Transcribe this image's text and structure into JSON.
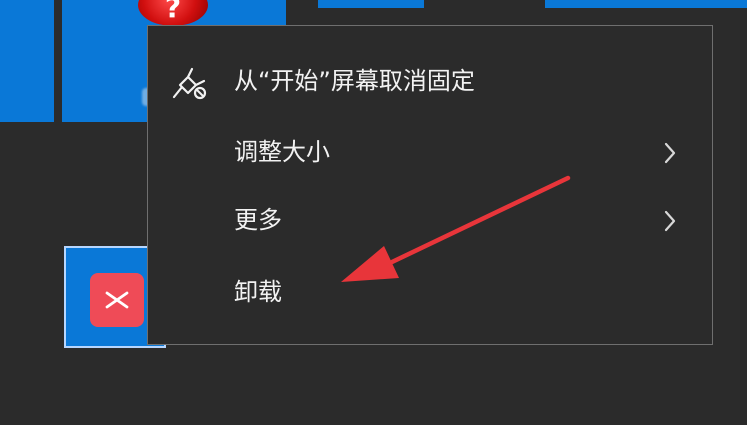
{
  "menu": {
    "items": [
      {
        "label": "从“开始”屏幕取消固定",
        "icon": "unpin-icon"
      },
      {
        "label": "调整大小",
        "icon": "chevron-right-icon"
      },
      {
        "label": "更多",
        "icon": "chevron-right-icon"
      },
      {
        "label": "卸载"
      }
    ]
  },
  "tiles": {
    "top_badge": "?"
  },
  "colors": {
    "desktop_background": "#2b2b2b",
    "tile_accent": "#0a78d7",
    "menu_background": "#2b2b2b",
    "menu_border": "#6f6f6f",
    "menu_text": "#f2f2f2",
    "annotation_arrow": "#e8353a",
    "app_icon_bg": "#ef4b57"
  }
}
